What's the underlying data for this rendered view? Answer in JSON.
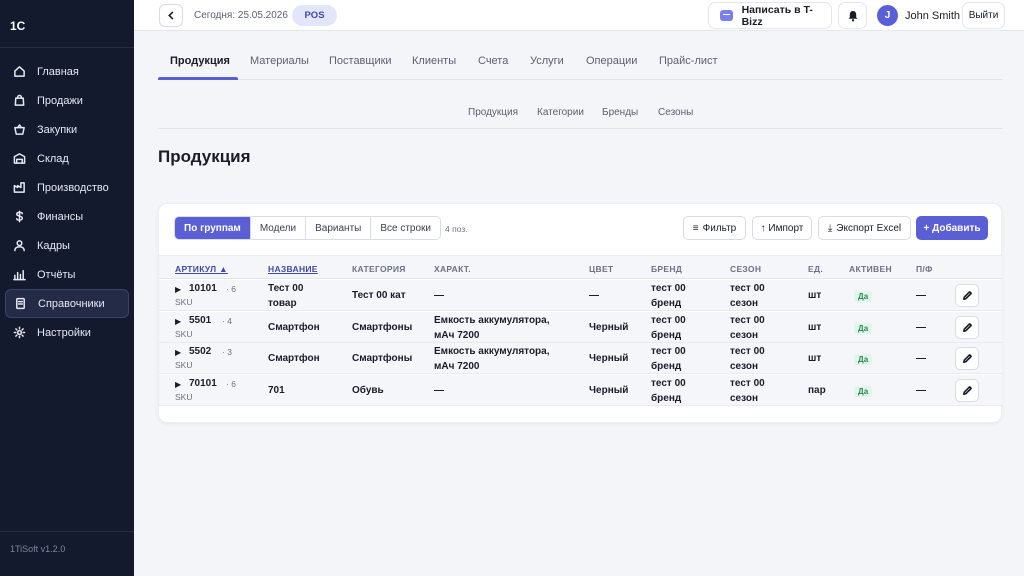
{
  "sidebar": {
    "logo": "1С",
    "items": [
      {
        "label": "Главная",
        "icon": "home-icon"
      },
      {
        "label": "Продажи",
        "icon": "bag-icon"
      },
      {
        "label": "Закупки",
        "icon": "basket-icon"
      },
      {
        "label": "Склад",
        "icon": "warehouse-icon"
      },
      {
        "label": "Производство",
        "icon": "factory-icon"
      },
      {
        "label": "Финансы",
        "icon": "dollar-icon"
      },
      {
        "label": "Кадры",
        "icon": "user-icon"
      },
      {
        "label": "Отчёты",
        "icon": "bar-chart-icon"
      },
      {
        "label": "Справочники",
        "icon": "book-icon",
        "active": true
      },
      {
        "label": "Настройки",
        "icon": "gear-icon"
      }
    ],
    "version": "1TiSoft v1.2.0"
  },
  "topbar": {
    "today": "Сегодня: 25.05.2026",
    "pos_label": "POS",
    "tbizz_label": "Написать в T-Bizz",
    "user_initial": "J",
    "user_name": "John Smith",
    "logout_label": "Выйти"
  },
  "tabs": [
    "Продукция",
    "Материалы",
    "Поставщики",
    "Клиенты",
    "Счета",
    "Услуги",
    "Операции",
    "Прайс-лист"
  ],
  "subtabs": [
    "Продукция",
    "Категории",
    "Бренды",
    "Сезоны"
  ],
  "page_title": "Продукция",
  "toolbar": {
    "views": [
      "По группам",
      "Модели",
      "Варианты",
      "Все строки"
    ],
    "active_view": "По группам",
    "count": "4 поз.",
    "filter_label": "Фильтр",
    "import_label": "↑ Импорт",
    "export_label": "Экспорт Excel",
    "add_label": "+ Добавить"
  },
  "table": {
    "columns": [
      "АРТИКУЛ ▲",
      "НАЗВАНИЕ",
      "КАТЕГОРИЯ",
      "ХАРАКТ.",
      "ЦВЕТ",
      "БРЕНД",
      "СЕЗОН",
      "ЕД.",
      "АКТИВЕН",
      "П/Ф"
    ],
    "rows": [
      {
        "code": "10101",
        "variants": "· 6",
        "sku": "SKU",
        "name": [
          "Тест 00",
          "товар"
        ],
        "category": "Тест 00 кат",
        "char": [
          "—"
        ],
        "color": "—",
        "brand": [
          "тест 00",
          "бренд"
        ],
        "season": [
          "тест 00",
          "сезон"
        ],
        "unit": "шт",
        "active": "Да",
        "pf": "—"
      },
      {
        "code": "5501",
        "variants": "· 4",
        "sku": "SKU",
        "name": [
          "Смартфон"
        ],
        "category": "Смартфоны",
        "char": [
          "Емкость аккумулятора,",
          "мАч 7200"
        ],
        "color": "Черный",
        "brand": [
          "тест 00",
          "бренд"
        ],
        "season": [
          "тест 00",
          "сезон"
        ],
        "unit": "шт",
        "active": "Да",
        "pf": "—"
      },
      {
        "code": "5502",
        "variants": "· 3",
        "sku": "SKU",
        "name": [
          "Смартфон"
        ],
        "category": "Смартфоны",
        "char": [
          "Емкость аккумулятора,",
          "мАч 7200"
        ],
        "color": "Черный",
        "brand": [
          "тест 00",
          "бренд"
        ],
        "season": [
          "тест 00",
          "сезон"
        ],
        "unit": "шт",
        "active": "Да",
        "pf": "—"
      },
      {
        "code": "70101",
        "variants": "· 6",
        "sku": "SKU",
        "name": [
          "701"
        ],
        "category": "Обувь",
        "char": [
          "—"
        ],
        "color": "Черный",
        "brand": [
          "тест 00",
          "бренд"
        ],
        "season": [
          "тест 00",
          "сезон"
        ],
        "unit": "пар",
        "active": "Да",
        "pf": "—"
      }
    ]
  }
}
